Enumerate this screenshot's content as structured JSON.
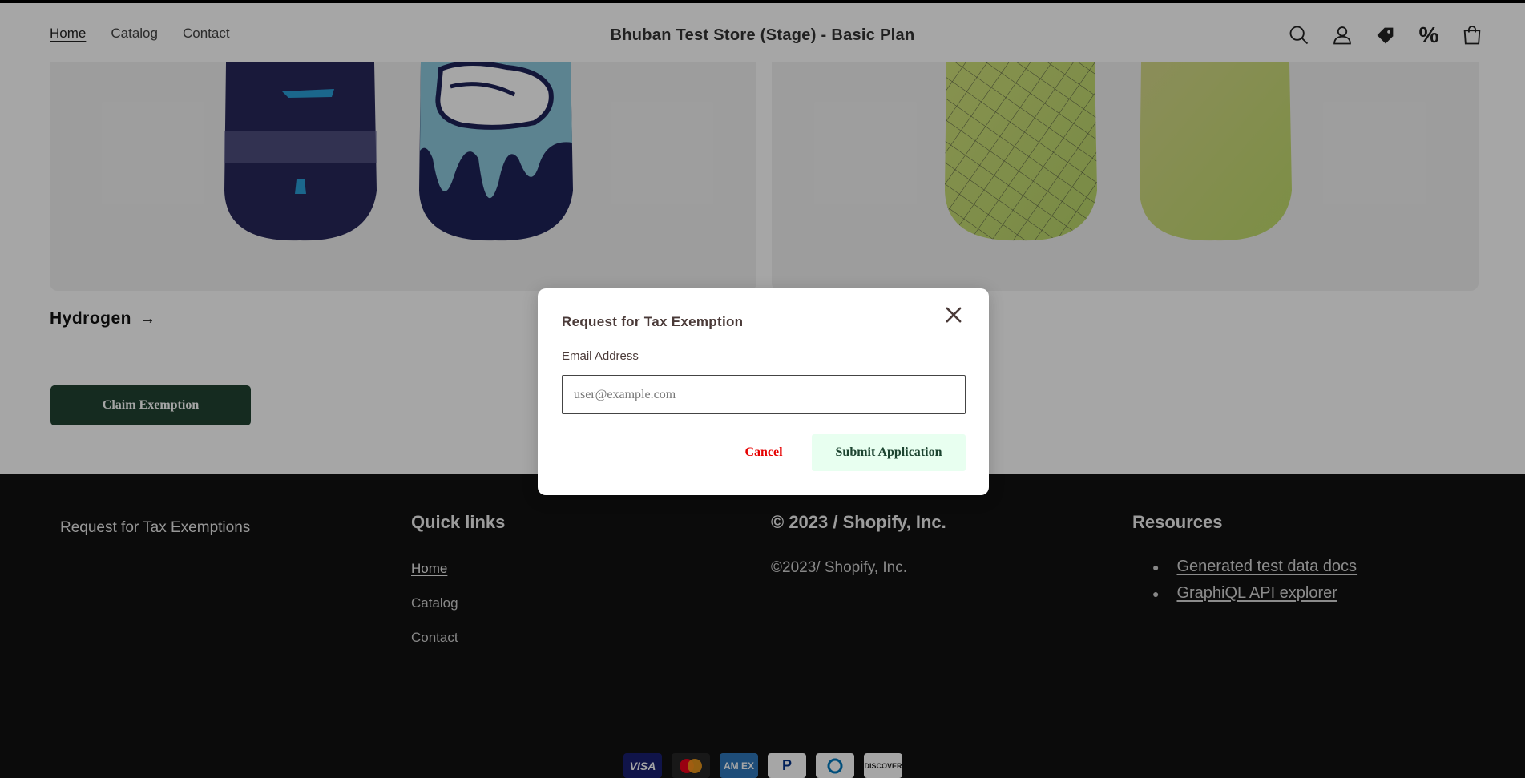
{
  "header": {
    "nav": [
      {
        "label": "Home"
      },
      {
        "label": "Catalog"
      },
      {
        "label": "Contact"
      }
    ],
    "store_title": "Bhuban Test Store (Stage) - Basic Plan",
    "icons": [
      "search-icon",
      "account-icon",
      "tag-icon",
      "percent-icon",
      "cart-icon"
    ],
    "percent_glyph": "%"
  },
  "main": {
    "collection_title": "Hydrogen",
    "collection_arrow": "→",
    "claim_button": "Claim Exemption"
  },
  "footer": {
    "tax_text": "Request for Tax Exemptions",
    "quick_links_title": "Quick links",
    "quick_links": [
      {
        "label": "Home"
      },
      {
        "label": "Catalog"
      },
      {
        "label": "Contact"
      }
    ],
    "copyright_title": "© 2023 / Shopify, Inc.",
    "copyright_text": "©2023/ Shopify, Inc.",
    "resources_title": "Resources",
    "resources": [
      {
        "label": "Generated test data docs"
      },
      {
        "label": "GraphiQL API explorer"
      }
    ],
    "payments": [
      "VISA",
      "Mastercard",
      "AM EX",
      "P",
      "Diners",
      "DISCOVER"
    ]
  },
  "modal": {
    "title": "Request for Tax Exemption",
    "email_label": "Email Address",
    "email_placeholder": "user@example.com",
    "email_value": "",
    "cancel_label": "Cancel",
    "submit_label": "Submit Application"
  },
  "colors": {
    "claim_button_bg": "#214332",
    "submit_button_bg": "#e8fff0",
    "cancel_text": "#e60000",
    "footer_bg": "#111111"
  }
}
